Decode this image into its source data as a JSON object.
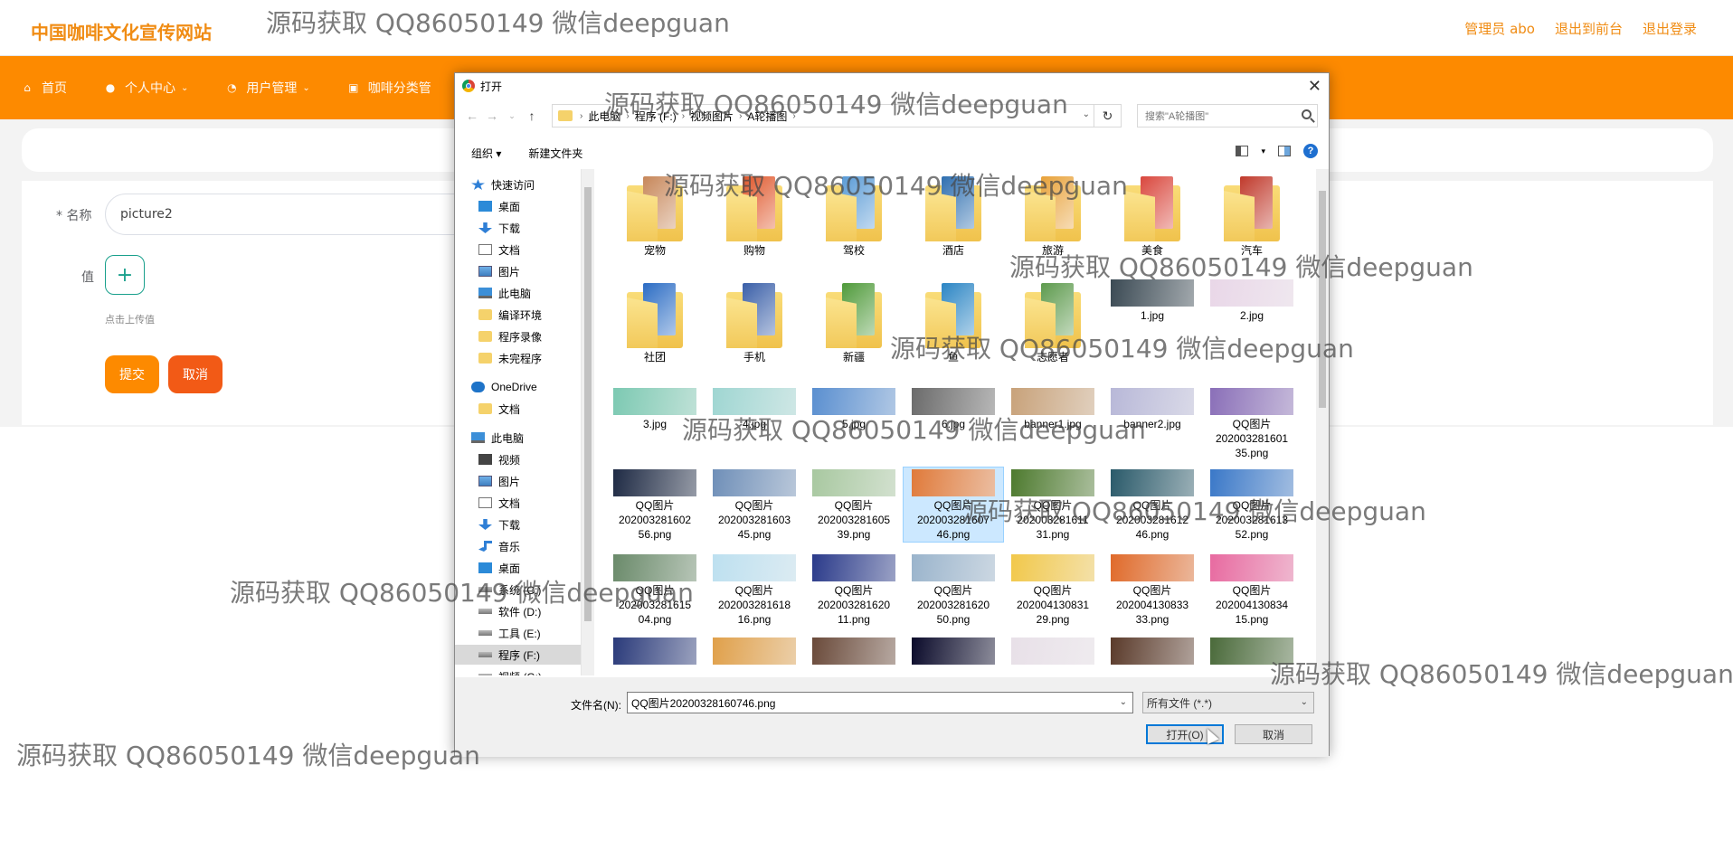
{
  "site": {
    "title": "中国咖啡文化宣传网站",
    "header_links": [
      "管理员 abo",
      "退出到前台",
      "退出登录"
    ]
  },
  "nav": {
    "items": [
      {
        "label": "首页",
        "icon": "home-icon"
      },
      {
        "label": "个人中心",
        "icon": "user-icon"
      },
      {
        "label": "用户管理",
        "icon": "users-icon"
      },
      {
        "label": "咖啡分类管",
        "icon": "category-icon"
      }
    ]
  },
  "form": {
    "name_label": "* 名称",
    "name_value": "picture2",
    "value_label": "值",
    "upload_hint": "点击上传值",
    "submit_label": "提交",
    "cancel_label": "取消"
  },
  "dialog": {
    "title": "打开",
    "close_symbol": "✕",
    "address_segments": [
      "此电脑",
      "程序 (F:)",
      "视频图片",
      "A轮播图"
    ],
    "search_placeholder": "搜索\"A轮播图\"",
    "toolbar": {
      "organize": "组织 ▾",
      "new_folder": "新建文件夹"
    },
    "nav_tree": [
      {
        "label": "快速访问",
        "icon": "star-icon",
        "indent": 0
      },
      {
        "label": "桌面",
        "icon": "desktop-icon",
        "indent": 1,
        "pinned": true
      },
      {
        "label": "下载",
        "icon": "download-icon",
        "indent": 1,
        "pinned": true
      },
      {
        "label": "文档",
        "icon": "document-icon",
        "indent": 1,
        "pinned": true
      },
      {
        "label": "图片",
        "icon": "picture-icon",
        "indent": 1,
        "pinned": true
      },
      {
        "label": "此电脑",
        "icon": "computer-icon",
        "indent": 1,
        "pinned": true
      },
      {
        "label": "编译环境",
        "icon": "folder-icon",
        "indent": 1
      },
      {
        "label": "程序录像",
        "icon": "folder-icon",
        "indent": 1
      },
      {
        "label": "未完程序",
        "icon": "folder-icon",
        "indent": 1
      },
      {
        "label": "OneDrive",
        "icon": "cloud-icon",
        "indent": 0
      },
      {
        "label": "文档",
        "icon": "folder-icon",
        "indent": 1
      },
      {
        "label": "此电脑",
        "icon": "computer-icon",
        "indent": 0
      },
      {
        "label": "视频",
        "icon": "video-icon",
        "indent": 1
      },
      {
        "label": "图片",
        "icon": "picture-icon",
        "indent": 1
      },
      {
        "label": "文档",
        "icon": "document-icon",
        "indent": 1
      },
      {
        "label": "下载",
        "icon": "download-icon",
        "indent": 1
      },
      {
        "label": "音乐",
        "icon": "music-icon",
        "indent": 1
      },
      {
        "label": "桌面",
        "icon": "desktop-icon",
        "indent": 1
      },
      {
        "label": "系统 (C:)",
        "icon": "drive-icon",
        "indent": 1
      },
      {
        "label": "软件 (D:)",
        "icon": "drive-icon",
        "indent": 1
      },
      {
        "label": "工具 (E:)",
        "icon": "drive-icon",
        "indent": 1
      },
      {
        "label": "程序 (F:)",
        "icon": "drive-icon",
        "indent": 1,
        "selected": true
      },
      {
        "label": "视频 (G:)",
        "icon": "drive-icon",
        "indent": 1
      }
    ],
    "files": [
      {
        "name": "宠物",
        "type": "folder",
        "color": "#c7875a"
      },
      {
        "name": "购物",
        "type": "folder",
        "color": "#e0572b"
      },
      {
        "name": "驾校",
        "type": "folder",
        "color": "#5a9bd6"
      },
      {
        "name": "酒店",
        "type": "folder",
        "color": "#2f6fb0"
      },
      {
        "name": "旅游",
        "type": "folder",
        "color": "#e8a23a"
      },
      {
        "name": "美食",
        "type": "folder",
        "color": "#d9473d"
      },
      {
        "name": "汽车",
        "type": "folder",
        "color": "#c0392b"
      },
      {
        "name": "社团",
        "type": "folder",
        "color": "#2b6cc4"
      },
      {
        "name": "手机",
        "type": "folder",
        "color": "#3a5fa8"
      },
      {
        "name": "新疆",
        "type": "folder",
        "color": "#4f9a3a"
      },
      {
        "name": "鱼",
        "type": "folder",
        "color": "#2b85c4"
      },
      {
        "name": "志愿者",
        "type": "folder",
        "color": "#5d9a4d"
      },
      {
        "name": "1.jpg",
        "type": "image",
        "color": "#3b4a54"
      },
      {
        "name": "2.jpg",
        "type": "image",
        "color": "#e9d7e8"
      },
      {
        "name": "3.jpg",
        "type": "image",
        "color": "#7cc9b2"
      },
      {
        "name": "4.jpg",
        "type": "image",
        "color": "#9fd6d2"
      },
      {
        "name": "5.jpg",
        "type": "image",
        "color": "#5a8fd0"
      },
      {
        "name": "6.jpg",
        "type": "image",
        "color": "#6b6b6b"
      },
      {
        "name": "banner1.jpg",
        "type": "image",
        "color": "#c8a27a"
      },
      {
        "name": "banner2.jpg",
        "type": "image",
        "color": "#b8b8d8"
      },
      {
        "name": "QQ图片20200328160135.png",
        "type": "image",
        "color": "#8a6fb8"
      },
      {
        "name": "QQ图片20200328160256.png",
        "type": "image",
        "color": "#1e2a44"
      },
      {
        "name": "QQ图片20200328160345.png",
        "type": "image",
        "color": "#6f8fb8"
      },
      {
        "name": "QQ图片20200328160539.png",
        "type": "image",
        "color": "#a8c8a0"
      },
      {
        "name": "QQ图片20200328160746.png",
        "type": "image",
        "color": "#e07a3a",
        "selected": true
      },
      {
        "name": "QQ图片20200328161131.png",
        "type": "image",
        "color": "#4d7a2e"
      },
      {
        "name": "QQ图片20200328161246.png",
        "type": "image",
        "color": "#2a5a6a"
      },
      {
        "name": "QQ图片20200328161352.png",
        "type": "image",
        "color": "#3a78c8"
      },
      {
        "name": "QQ图片20200328161504.png",
        "type": "image",
        "color": "#6a8a6a"
      },
      {
        "name": "QQ图片20200328161816.png",
        "type": "image",
        "color": "#bde0f0"
      },
      {
        "name": "QQ图片20200328162011.png",
        "type": "image",
        "color": "#2a3a8a"
      },
      {
        "name": "QQ图片20200328162050.png",
        "type": "image",
        "color": "#9ab4cc"
      },
      {
        "name": "QQ图片20200413083129.png",
        "type": "image",
        "color": "#f2c84a"
      },
      {
        "name": "QQ图片20200413083333.png",
        "type": "image",
        "color": "#e06a2a"
      },
      {
        "name": "QQ图片20200413083415.png",
        "type": "image",
        "color": "#e86aa0"
      },
      {
        "name": "",
        "type": "image",
        "color": "#2a3a7a"
      },
      {
        "name": "",
        "type": "image",
        "color": "#e0a04a"
      },
      {
        "name": "",
        "type": "image",
        "color": "#6a4a3a"
      },
      {
        "name": "",
        "type": "image",
        "color": "#0a0a2a"
      },
      {
        "name": "",
        "type": "image",
        "color": "#e8e0e8"
      },
      {
        "name": "",
        "type": "image",
        "color": "#5a3a2a"
      },
      {
        "name": "",
        "type": "image",
        "color": "#4a6a3a"
      }
    ],
    "filename_label": "文件名(N):",
    "filename_value": "QQ图片20200328160746.png",
    "filetype_value": "所有文件 (*.*)",
    "open_label": "打开(O)",
    "cancel_label": "取消"
  },
  "watermarks": [
    "源码获取 QQ86050149 微信deepguan"
  ]
}
